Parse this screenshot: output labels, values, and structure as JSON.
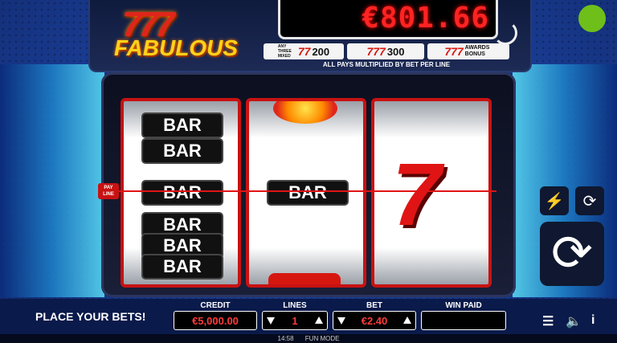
{
  "logo": {
    "sevens": "777",
    "word": "FABULOUS"
  },
  "meter": {
    "value": "€801.66"
  },
  "paytable": [
    {
      "prefix": "ANY THREE MIXED",
      "symbol": "77",
      "amount": "200"
    },
    {
      "prefix": "",
      "symbol": "777",
      "amount": "300"
    },
    {
      "prefix": "",
      "symbol": "777",
      "amount": "AWARDS BONUS"
    }
  ],
  "paytable_note": "ALL PAYS MULTIPLIED BY BET PER LINE",
  "payline_tag": "PAY LINE",
  "reels": {
    "reel1": [
      "BAR",
      "BAR",
      "BAR",
      "BAR",
      "BAR",
      "BAR"
    ],
    "reel2": [
      "BAR"
    ],
    "reel3_symbol": "7"
  },
  "controls": {
    "place_bets": "PLACE YOUR BETS!",
    "credit_label": "CREDIT",
    "credit_value": "€5,000.00",
    "lines_label": "LINES",
    "lines_value": "1",
    "bet_label": "BET",
    "bet_value": "€2.40",
    "winpaid_label": "WIN PAID",
    "winpaid_value": ""
  },
  "footer": {
    "time": "14:58",
    "mode": "FUN MODE"
  },
  "icons": [
    "turbo-icon",
    "autoplay-icon",
    "spin-icon",
    "menu-icon",
    "sound-icon",
    "info-icon"
  ],
  "colors": {
    "accent_red": "#e01414",
    "gold": "#ffd21a",
    "status_green": "#6fbf1a"
  }
}
